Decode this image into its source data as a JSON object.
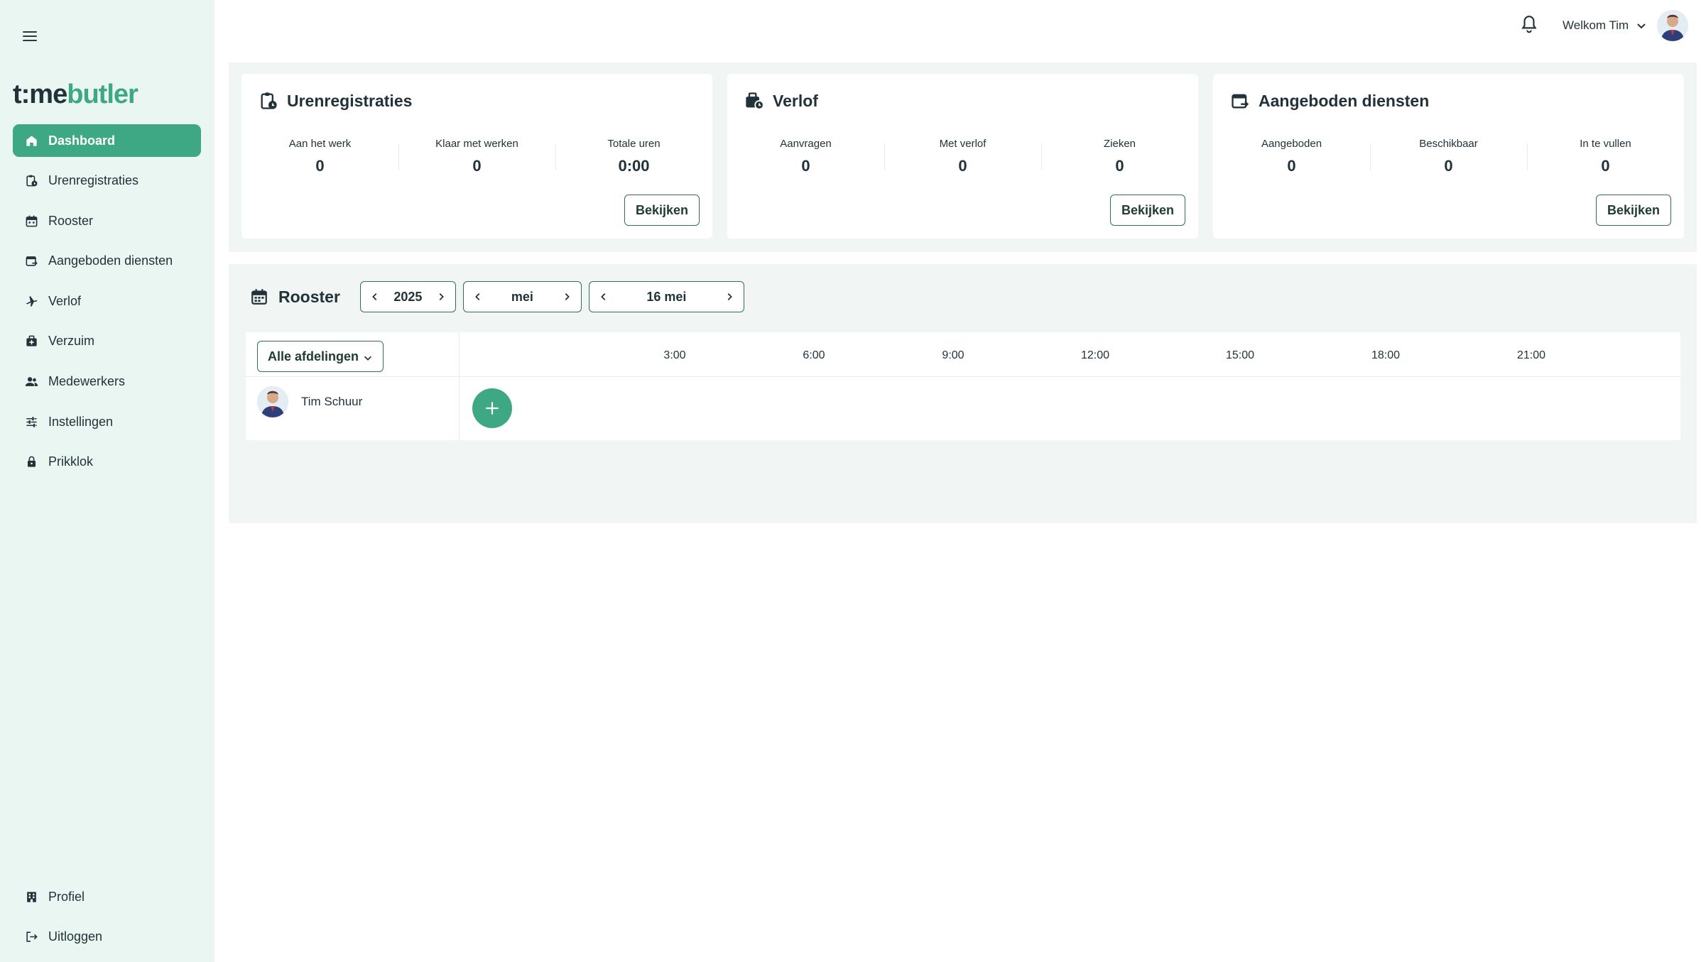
{
  "brand": {
    "logo_part1": "t:me",
    "logo_part2": "butler"
  },
  "sidebar": {
    "items": [
      {
        "label": "Dashboard",
        "icon": "home-icon"
      },
      {
        "label": "Urenregistraties",
        "icon": "clipboard-clock-icon"
      },
      {
        "label": "Rooster",
        "icon": "calendar-icon"
      },
      {
        "label": "Aangeboden diensten",
        "icon": "calendar-swap-icon"
      },
      {
        "label": "Verlof",
        "icon": "plane-icon"
      },
      {
        "label": "Verzuim",
        "icon": "medical-bag-icon"
      },
      {
        "label": "Medewerkers",
        "icon": "users-icon"
      },
      {
        "label": "Instellingen",
        "icon": "sliders-icon"
      },
      {
        "label": "Prikklok",
        "icon": "lock-icon"
      }
    ],
    "bottom_items": [
      {
        "label": "Profiel",
        "icon": "building-icon"
      },
      {
        "label": "Uitloggen",
        "icon": "logout-icon"
      }
    ]
  },
  "header": {
    "welcome": "Welkom Tim"
  },
  "cards": [
    {
      "title": "Urenregistraties",
      "icon": "clipboard-clock-icon",
      "stats": [
        {
          "label": "Aan het werk",
          "value": "0"
        },
        {
          "label": "Klaar met werken",
          "value": "0"
        },
        {
          "label": "Totale uren",
          "value": "0:00"
        }
      ],
      "button": "Bekijken"
    },
    {
      "title": "Verlof",
      "icon": "briefcase-clock-icon",
      "stats": [
        {
          "label": "Aanvragen",
          "value": "0"
        },
        {
          "label": "Met verlof",
          "value": "0"
        },
        {
          "label": "Zieken",
          "value": "0"
        }
      ],
      "button": "Bekijken"
    },
    {
      "title": "Aangeboden diensten",
      "icon": "calendar-swap-icon",
      "stats": [
        {
          "label": "Aangeboden",
          "value": "0"
        },
        {
          "label": "Beschikbaar",
          "value": "0"
        },
        {
          "label": "In te vullen",
          "value": "0"
        }
      ],
      "button": "Bekijken"
    }
  ],
  "rooster": {
    "title": "Rooster",
    "year": "2025",
    "month": "mei",
    "day": "16 mei",
    "department_filter": "Alle afdelingen",
    "hours": [
      "3:00",
      "6:00",
      "9:00",
      "12:00",
      "15:00",
      "18:00",
      "21:00"
    ],
    "employee": {
      "name": "Tim Schuur"
    }
  },
  "colors": {
    "accent": "#3ea784",
    "sidebar_bg": "#eaf6f1",
    "panel_bg": "#f1f5f4",
    "border": "#2f6f5a"
  }
}
